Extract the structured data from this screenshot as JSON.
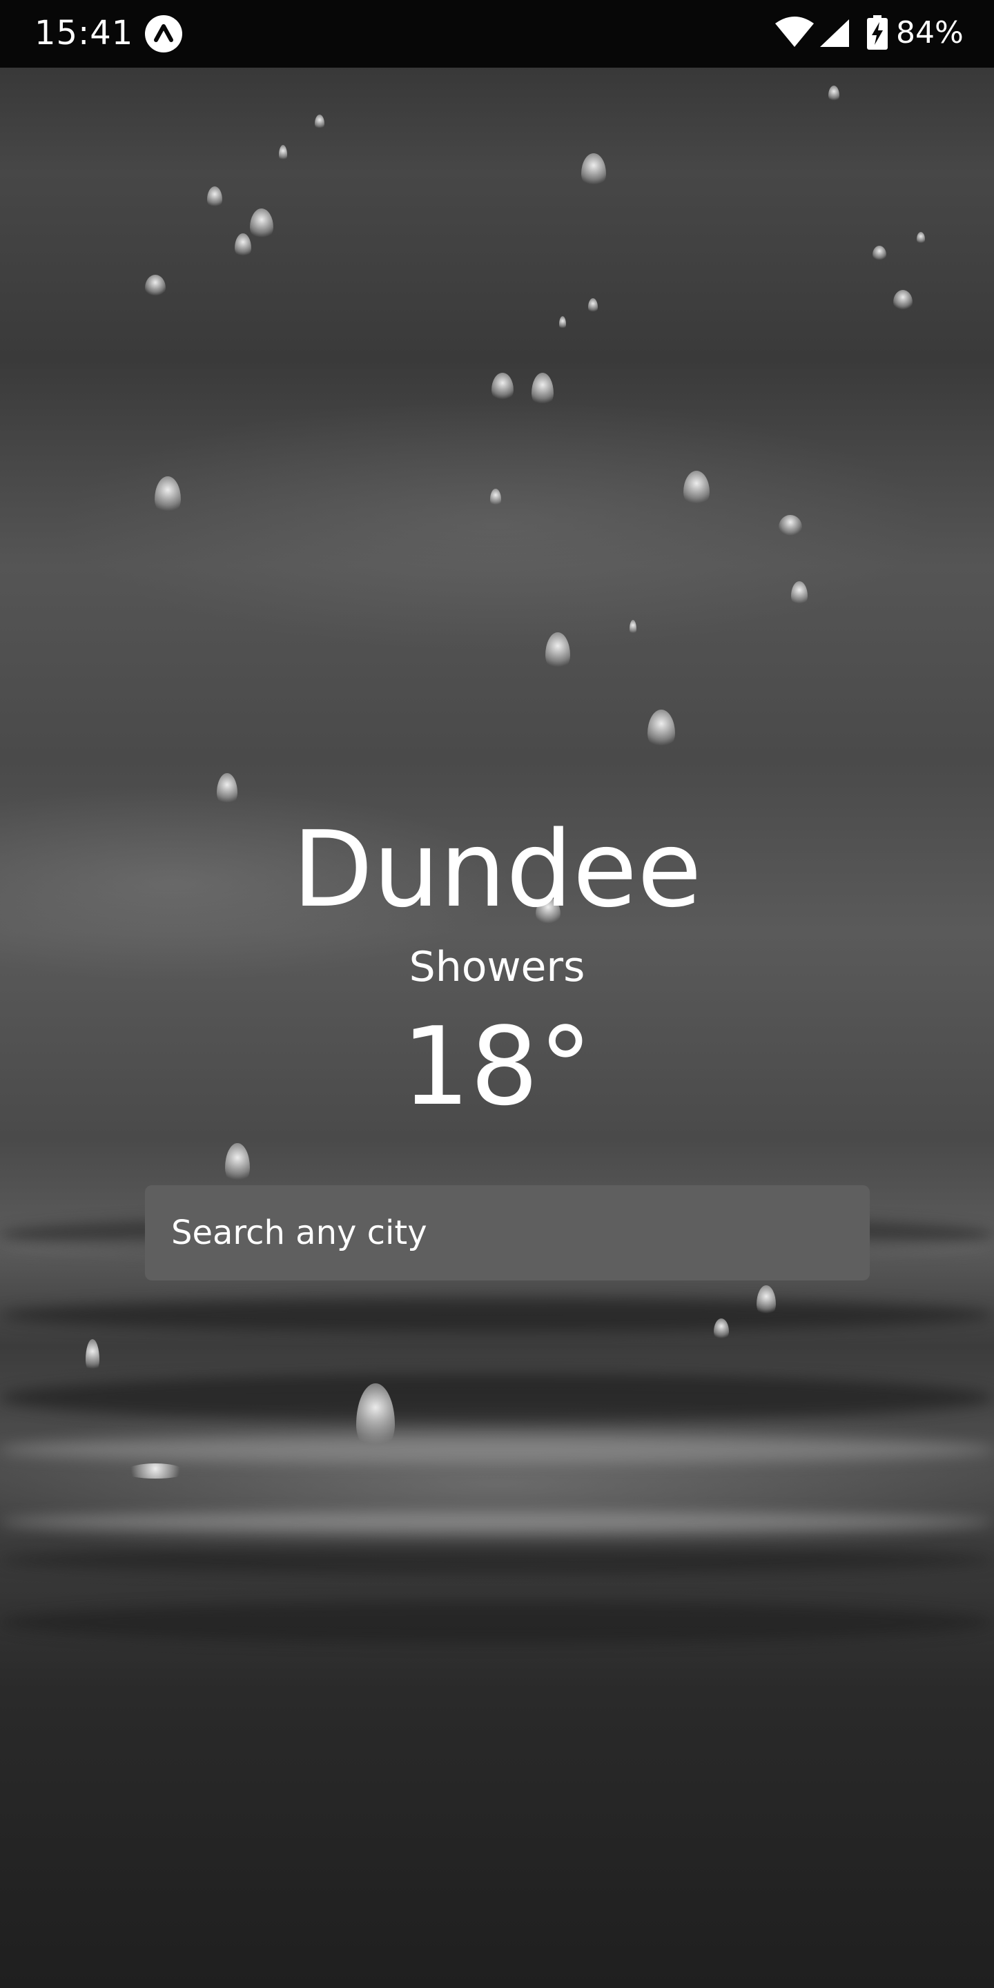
{
  "status_bar": {
    "time": "15:41",
    "battery_percent": "84%",
    "icons": [
      "app-notification-icon",
      "wifi-icon",
      "cellular-signal-icon",
      "battery-charging-icon"
    ]
  },
  "weather": {
    "city": "Dundee",
    "condition": "Showers",
    "temperature": "18°"
  },
  "search": {
    "placeholder": "Search any city"
  },
  "background": {
    "description": "rain-drops-water-monochrome",
    "text_color": "#ffffff",
    "status_bar_color": "#070707",
    "search_box_color": "#5f5f5f"
  }
}
